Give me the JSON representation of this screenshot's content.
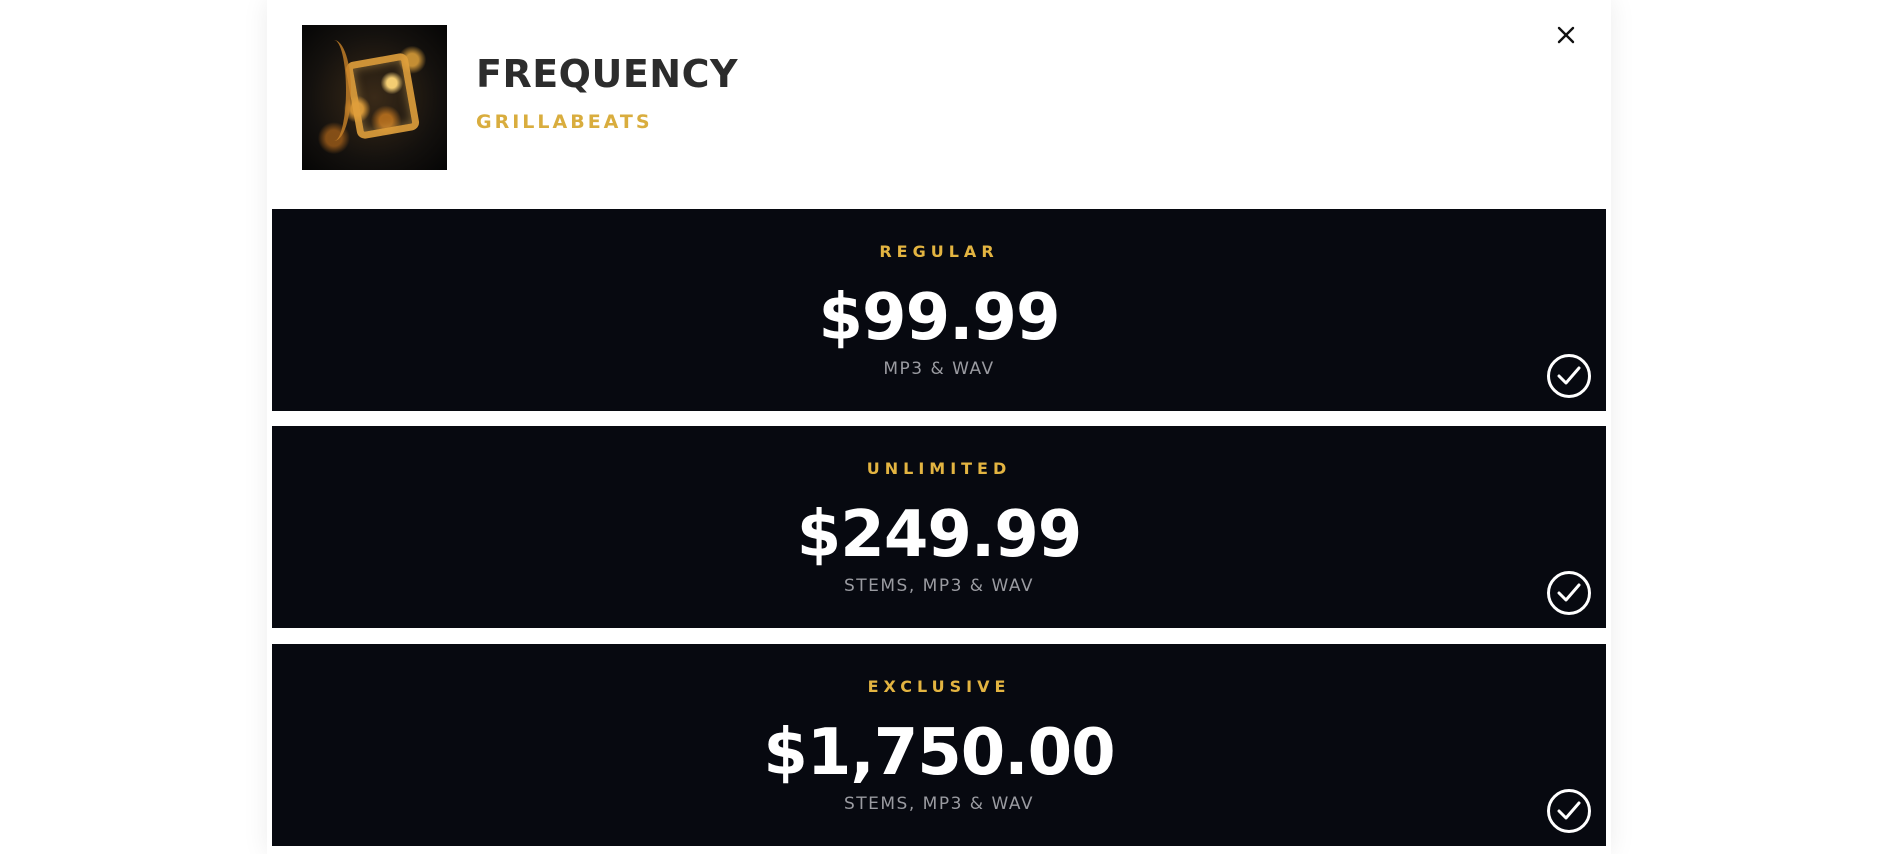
{
  "track": {
    "title": "FREQUENCY",
    "artist": "GRILLABEATS"
  },
  "icons": {
    "close": "close-icon",
    "select": "checkmark-circle-icon"
  },
  "colors": {
    "accent": "#e3b441",
    "card_background": "#070910",
    "title_text": "#2c2c2c",
    "muted_text": "#9a9ba1"
  },
  "licenses": [
    {
      "name": "REGULAR",
      "price": "$99.99",
      "files": "MP3 & WAV"
    },
    {
      "name": "UNLIMITED",
      "price": "$249.99",
      "files": "STEMS, MP3 & WAV"
    },
    {
      "name": "EXCLUSIVE",
      "price": "$1,750.00",
      "files": "STEMS, MP3 & WAV"
    }
  ]
}
